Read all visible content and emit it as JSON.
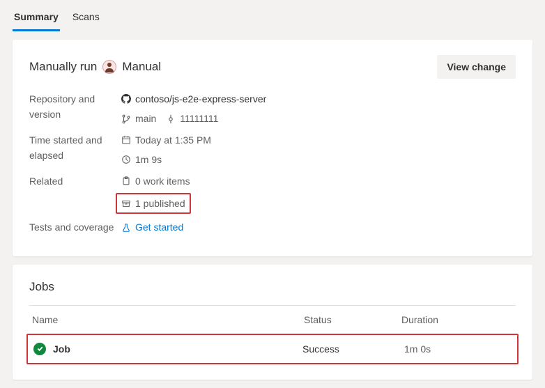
{
  "tabs": {
    "summary": "Summary",
    "scans": "Scans"
  },
  "summary": {
    "run_prefix": "Manually run",
    "run_suffix": "Manual",
    "view_change": "View change",
    "labels": {
      "repo": "Repository and version",
      "time": "Time started and elapsed",
      "related": "Related",
      "tests": "Tests and coverage"
    },
    "repo_name": "contoso/js-e2e-express-server",
    "branch": "main",
    "commit": "11111111",
    "date": "Today at 1:35 PM",
    "elapsed": "1m 9s",
    "work_items": "0 work items",
    "published": "1 published",
    "get_started": "Get started"
  },
  "jobs": {
    "title": "Jobs",
    "cols": {
      "name": "Name",
      "status": "Status",
      "duration": "Duration"
    },
    "row": {
      "name": "Job",
      "status": "Success",
      "duration": "1m 0s"
    }
  }
}
